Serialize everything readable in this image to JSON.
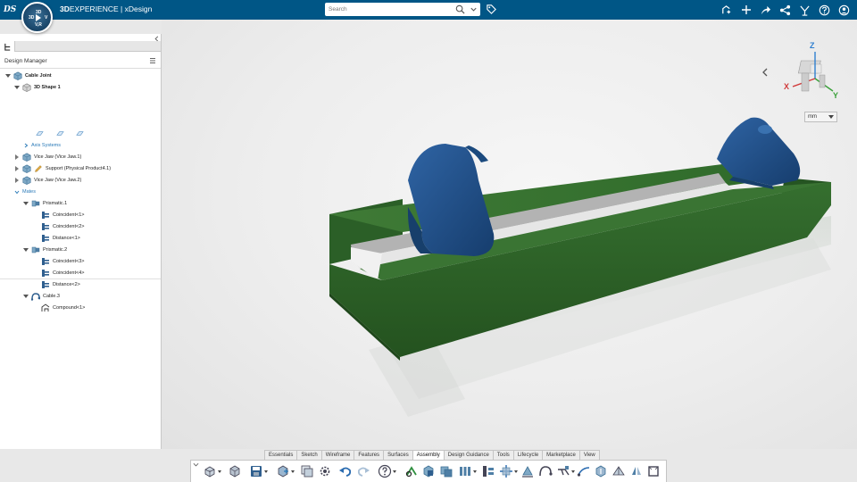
{
  "app": {
    "brand_prefix": "3D",
    "brand_main": "EXPERIENCE",
    "brand_separator": " | ",
    "brand_app": "xDesign",
    "logo": "DS"
  },
  "compass": {
    "north": "3D",
    "west": "3D",
    "east": "V",
    "south": "V,R"
  },
  "search": {
    "placeholder": "Search",
    "value": ""
  },
  "top_icons": [
    "add-content-icon",
    "plus-icon",
    "share-icon",
    "network-icon",
    "collaborate-icon",
    "help-icon",
    "user-icon"
  ],
  "design_manager": {
    "title": "Design Manager",
    "tree": [
      {
        "label": "Cable Joint",
        "level": 0,
        "expanded": true,
        "bold": true,
        "icon": "assembly-icon"
      },
      {
        "label": "3D Shape 1",
        "level": 1,
        "expanded": true,
        "bold": true,
        "icon": "shape-icon"
      },
      {
        "label": "Axis Systems",
        "level": 1,
        "expanded": false,
        "blue": true,
        "icon": ""
      },
      {
        "label": "Vice Jaw (Vice Jaw.1)",
        "level": 1,
        "expanded": false,
        "icon": "part-icon"
      },
      {
        "label": "Support (Physical Product4.1)",
        "level": 1,
        "expanded": false,
        "icon": "part-icon"
      },
      {
        "label": "Vice Jaw (Vice Jaw.2)",
        "level": 1,
        "expanded": false,
        "icon": "part-icon"
      },
      {
        "label": "Mates",
        "level": 1,
        "expanded": true,
        "blue": true,
        "icon": ""
      },
      {
        "label": "Prismatic.1",
        "level": 2,
        "expanded": true,
        "icon": "mate-icon"
      },
      {
        "label": "Coincident<1>",
        "level": 3,
        "icon": "constraint-icon"
      },
      {
        "label": "Coincident<2>",
        "level": 3,
        "icon": "constraint-icon"
      },
      {
        "label": "Distance<1>",
        "level": 3,
        "icon": "constraint-icon"
      },
      {
        "label": "Prismatic.2",
        "level": 2,
        "expanded": true,
        "icon": "mate-icon"
      },
      {
        "label": "Coincident<3>",
        "level": 3,
        "icon": "constraint-icon"
      },
      {
        "label": "Coincident<4>",
        "level": 3,
        "icon": "constraint-icon"
      },
      {
        "label": "Distance<2>",
        "level": 3,
        "icon": "constraint-icon"
      },
      {
        "label": "Cable.3",
        "level": 2,
        "expanded": true,
        "icon": "cable-icon"
      },
      {
        "label": "Compound<1>",
        "level": 3,
        "icon": "compound-icon"
      }
    ]
  },
  "viewport": {
    "units": "mm",
    "triad": {
      "x": "X",
      "y": "Y",
      "z": "Z"
    },
    "colors": {
      "base_green": "#2f6b2c",
      "jaw_blue": "#1e4e8c",
      "rail_grey": "#a9a9a9"
    }
  },
  "action_bar": {
    "tabs": [
      "Essentials",
      "Sketch",
      "Wireframe",
      "Features",
      "Surfaces",
      "Assembly",
      "Design Guidance",
      "Tools",
      "Lifecycle",
      "Marketplace",
      "View"
    ],
    "active_tab": "Assembly",
    "tools": [
      "insert-icon",
      "shape-icon",
      "save-icon",
      "compose-icon",
      "collection-icon",
      "settings-icon",
      "undo-icon",
      "redo-icon",
      "help-icon",
      "mate-icon",
      "fix-icon",
      "duplicate-icon",
      "pattern-icon",
      "explode-icon",
      "move-icon",
      "flexible-icon",
      "cable-icon",
      "harness-icon",
      "route-icon",
      "clash-icon",
      "section-icon",
      "symmetry-icon",
      "frame-icon",
      "interference-icon"
    ]
  }
}
